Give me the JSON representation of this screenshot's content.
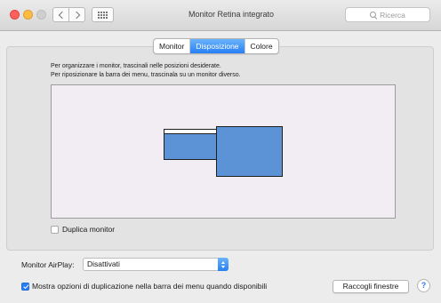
{
  "window": {
    "title": "Monitor Retina integrato",
    "search_placeholder": "Ricerca"
  },
  "tabs": [
    {
      "label": "Monitor",
      "active": false
    },
    {
      "label": "Disposizione",
      "active": true
    },
    {
      "label": "Colore",
      "active": false
    }
  ],
  "arrangement": {
    "instruction_1": "Per organizzare i monitor, trascinali nelle posizioni desiderate.",
    "instruction_2": "Per riposizionare la barra dei menu, trascinala su un monitor diverso.",
    "duplicate_label": "Duplica monitor",
    "duplicate_checked": false
  },
  "airplay": {
    "label": "Monitor AirPlay:",
    "selected": "Disattivati"
  },
  "footer": {
    "mirror_label": "Mostra opzioni di duplicazione nella barra dei menu quando disponibili",
    "mirror_checked": true,
    "gather_button": "Raccogli finestre",
    "help": "?"
  },
  "colors": {
    "accent": "#2a7ff6",
    "monitor": "#5b93d6",
    "arrangement_bg": "#f2edf3"
  }
}
